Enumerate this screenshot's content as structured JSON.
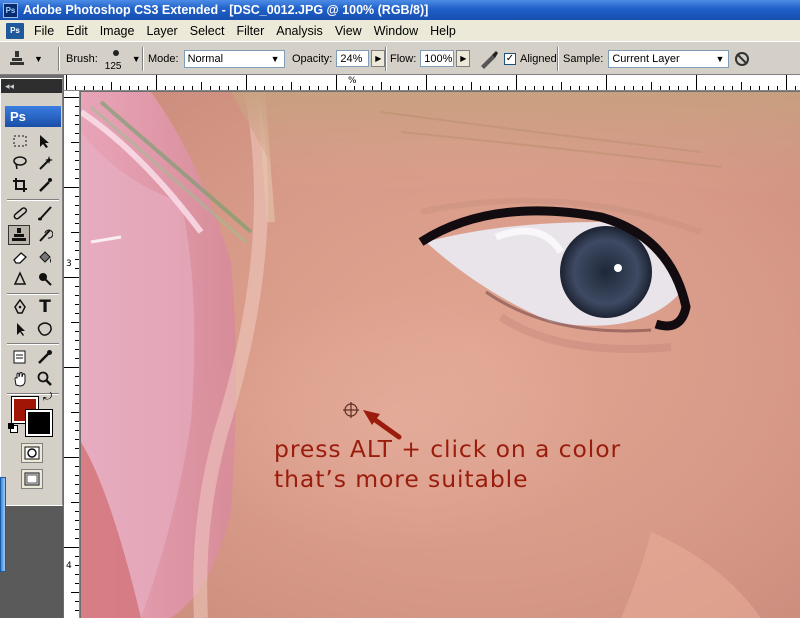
{
  "title_bar": {
    "icon": "Ps",
    "title": "Adobe Photoshop CS3 Extended - [DSC_0012.JPG @ 100% (RGB/8)]"
  },
  "menu": {
    "app_icon": "Ps",
    "items": [
      "File",
      "Edit",
      "Image",
      "Layer",
      "Select",
      "Filter",
      "Analysis",
      "View",
      "Window",
      "Help"
    ]
  },
  "options_bar": {
    "brush_label": "Brush:",
    "brush_size": "125",
    "mode_label": "Mode:",
    "mode_value": "Normal",
    "opacity_label": "Opacity:",
    "opacity_value": "24%",
    "flow_label": "Flow:",
    "flow_value": "100%",
    "aligned_label": "Aligned",
    "aligned_checked": true,
    "sample_label": "Sample:",
    "sample_value": "Current Layer"
  },
  "toolbox": {
    "logo": "Ps",
    "active_tool": "clone-stamp-tool",
    "foreground_color": "#a01506",
    "background_color": "#000000"
  },
  "rulers": {
    "top": [
      "%"
    ],
    "left": [
      "3",
      "4"
    ]
  },
  "annotation": {
    "line1": "press ALT + click on a color",
    "line2": "that’s more suitable",
    "color": "#9a1c0c"
  }
}
